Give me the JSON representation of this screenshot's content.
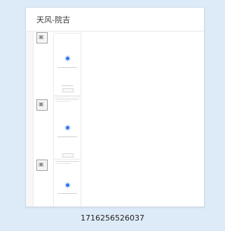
{
  "title": "天风-院吉",
  "caption": "1716256526037",
  "icon_names": [
    "image-placeholder-icon",
    "spinner-dot-icon"
  ],
  "colors": {
    "background": "#ddeaf7",
    "card": "#ffffff",
    "accent": "#2f74e8"
  }
}
